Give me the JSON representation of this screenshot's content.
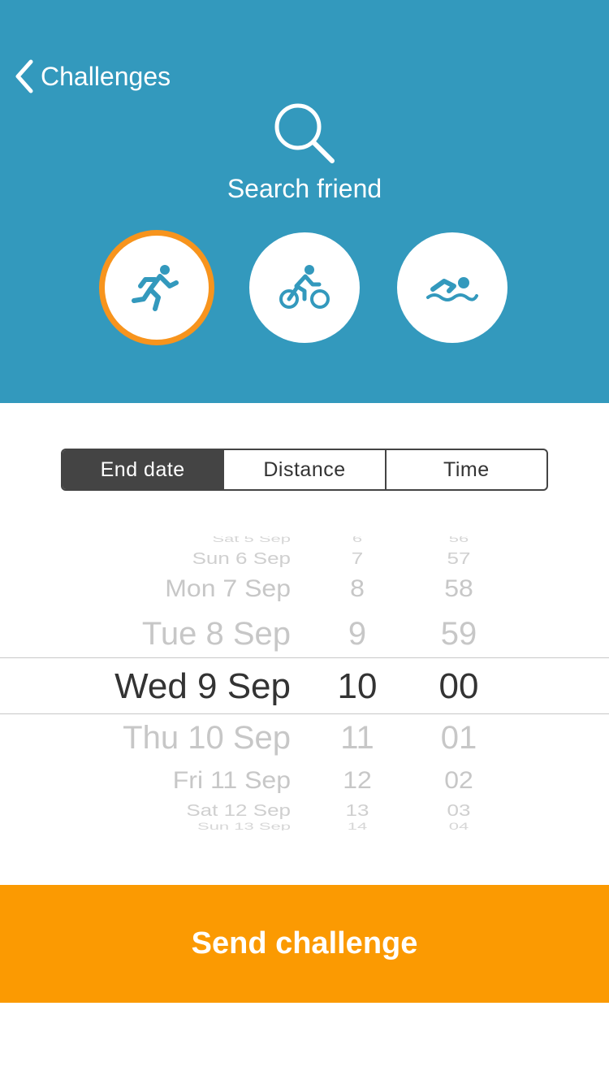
{
  "header": {
    "back_label": "Challenges",
    "search_label": "Search friend",
    "background": "#3399bd"
  },
  "sports": [
    {
      "icon": "running-icon",
      "selected": true
    },
    {
      "icon": "cycling-icon",
      "selected": false
    },
    {
      "icon": "swimming-icon",
      "selected": false
    }
  ],
  "accent_color": "#f7941d",
  "segments": {
    "items": [
      "End date",
      "Distance",
      "Time"
    ],
    "selected": "End date"
  },
  "picker": {
    "dates": [
      "Sat 5 Sep",
      "Sun 6 Sep",
      "Mon 7 Sep",
      "Tue 8 Sep",
      "Wed 9 Sep",
      "Thu 10 Sep",
      "Fri 11 Sep",
      "Sat 12 Sep",
      "Sun 13 Sep"
    ],
    "hours": [
      "6",
      "7",
      "8",
      "9",
      "10",
      "11",
      "12",
      "13",
      "14"
    ],
    "minutes": [
      "56",
      "57",
      "58",
      "59",
      "00",
      "01",
      "02",
      "03",
      "04"
    ],
    "selected": {
      "date": "Wed 9 Sep",
      "hour": "10",
      "minute": "00"
    }
  },
  "send_button": {
    "label": "Send challenge",
    "color": "#fb9a02"
  }
}
